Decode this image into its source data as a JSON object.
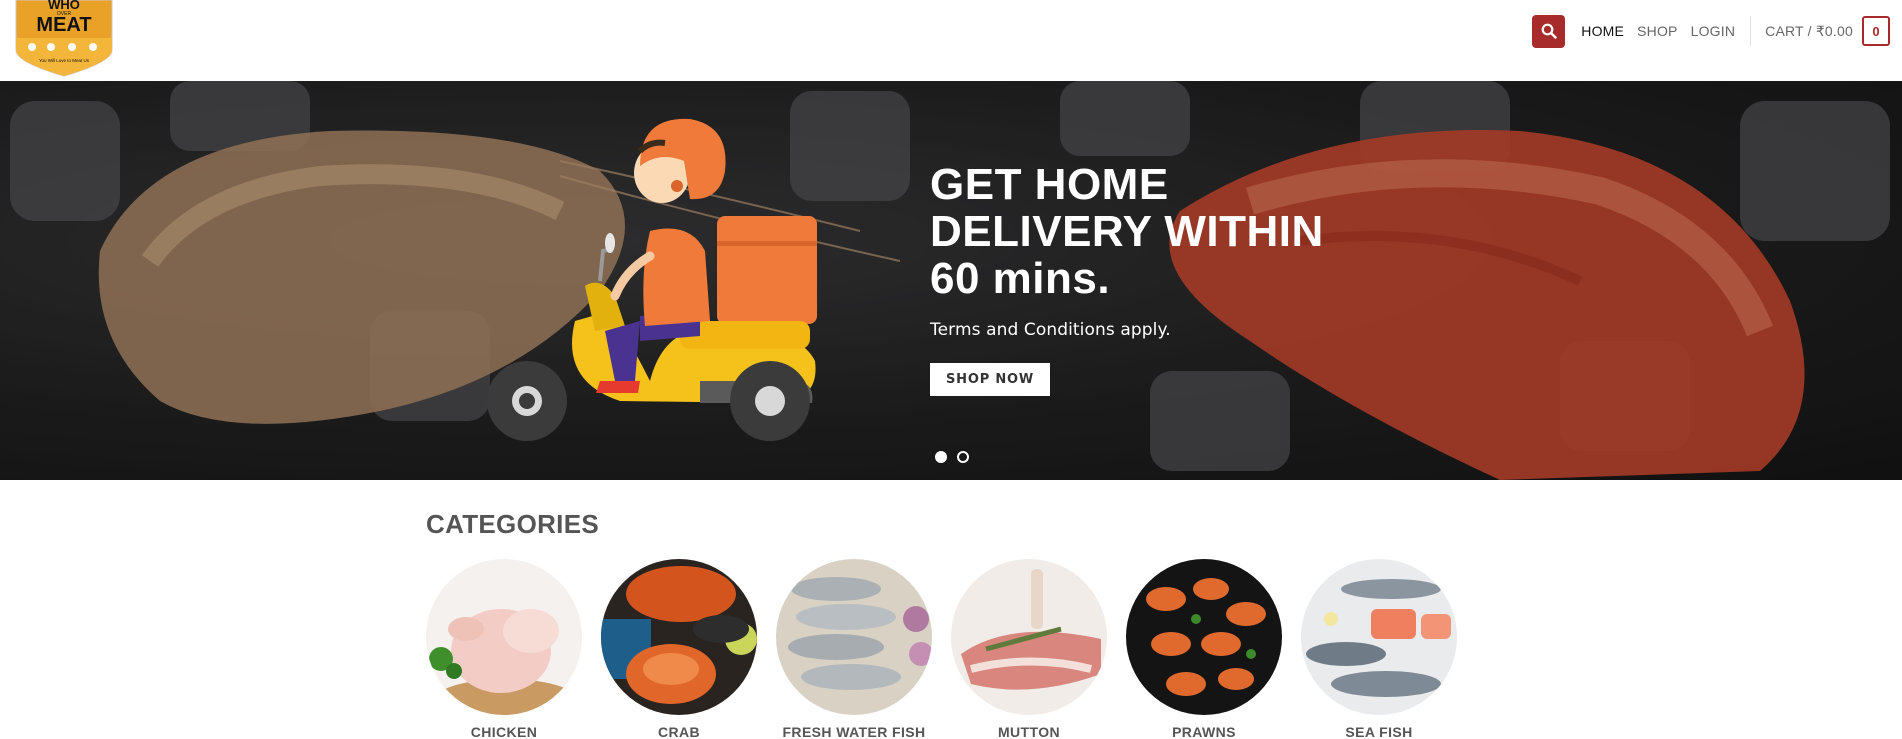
{
  "header": {
    "logo_text_top": "WHO",
    "logo_text_mid": "OVER",
    "logo_text_main": "MEAT",
    "logo_tagline": "You Will Love to Meat Us",
    "nav": [
      {
        "label": "HOME",
        "active": true
      },
      {
        "label": "SHOP",
        "active": false
      },
      {
        "label": "LOGIN",
        "active": false
      }
    ],
    "cart_label": "CART / ₹0.00",
    "cart_count": "0",
    "accent_color": "#a72b2b"
  },
  "hero": {
    "title_line1": "GET HOME",
    "title_line2": "DELIVERY WITHIN",
    "title_line3": "60 mins.",
    "subtitle": "Terms and Conditions apply.",
    "button_label": "SHOP NOW",
    "slide_count": 2,
    "active_slide": 1
  },
  "categories": {
    "heading": "CATEGORIES",
    "items": [
      {
        "label": "CHICKEN"
      },
      {
        "label": "CRAB"
      },
      {
        "label": "FRESH WATER FISH"
      },
      {
        "label": "MUTTON"
      },
      {
        "label": "PRAWNS"
      },
      {
        "label": "SEA FISH"
      }
    ]
  }
}
